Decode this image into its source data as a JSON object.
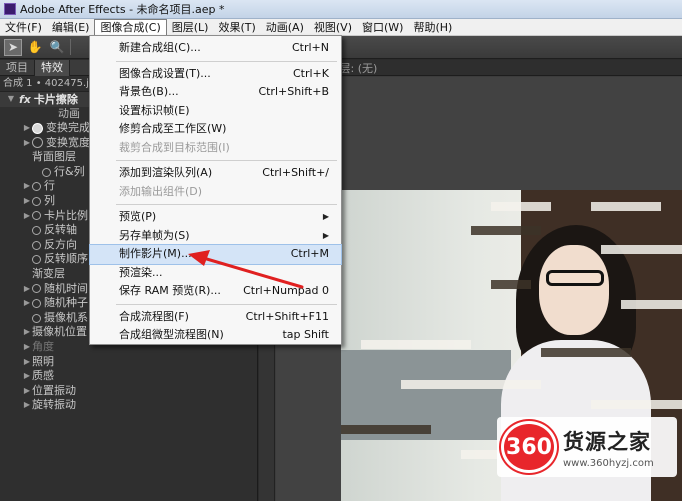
{
  "window": {
    "title": "Adobe After Effects - 未命名项目.aep *"
  },
  "menubar": {
    "items": [
      "文件(F)",
      "编辑(E)",
      "图像合成(C)",
      "图层(L)",
      "效果(T)",
      "动画(A)",
      "视图(V)",
      "窗口(W)",
      "帮助(H)"
    ],
    "active_index": 2
  },
  "left_panel": {
    "tabs": [
      "项目",
      "特效"
    ],
    "comp_label": "合成 1 • 402475.jp",
    "effect_name": "卡片擦除",
    "effect_sub": "动画",
    "properties": [
      {
        "label": "变换完成",
        "indent": 1,
        "tri": true,
        "stopwatch": "on"
      },
      {
        "label": "变换宽度",
        "indent": 1,
        "tri": true,
        "stopwatch": "off"
      },
      {
        "label": "背面图层",
        "indent": 1,
        "tri": false,
        "stopwatch": "none"
      },
      {
        "label": "行&列",
        "indent": 2,
        "tri": false,
        "stopwatch": "small"
      },
      {
        "label": "行",
        "indent": 1,
        "tri": true,
        "stopwatch": "small"
      },
      {
        "label": "列",
        "indent": 1,
        "tri": true,
        "stopwatch": "small"
      },
      {
        "label": "卡片比例",
        "indent": 1,
        "tri": true,
        "stopwatch": "small"
      },
      {
        "label": "反转轴",
        "indent": 1,
        "tri": false,
        "stopwatch": "small"
      },
      {
        "label": "反方向",
        "indent": 1,
        "tri": false,
        "stopwatch": "small"
      },
      {
        "label": "反转顺序",
        "indent": 1,
        "tri": false,
        "stopwatch": "small"
      },
      {
        "label": "渐变层",
        "indent": 1,
        "tri": false,
        "stopwatch": "none"
      },
      {
        "label": "随机时间",
        "indent": 1,
        "tri": true,
        "stopwatch": "small"
      },
      {
        "label": "随机种子",
        "indent": 1,
        "tri": true,
        "stopwatch": "small"
      },
      {
        "label": "摄像机系",
        "indent": 1,
        "tri": false,
        "stopwatch": "small"
      },
      {
        "label": "摄像机位置",
        "indent": 0,
        "tri": true,
        "stopwatch": "none"
      },
      {
        "label": "角度",
        "indent": 0,
        "tri": true,
        "stopwatch": "none",
        "dim": true
      },
      {
        "label": "照明",
        "indent": 0,
        "tri": true,
        "stopwatch": "none"
      },
      {
        "label": "质感",
        "indent": 0,
        "tri": true,
        "stopwatch": "none"
      },
      {
        "label": "位置振动",
        "indent": 0,
        "tri": true,
        "stopwatch": "none"
      },
      {
        "label": "旋转振动",
        "indent": 0,
        "tri": true,
        "stopwatch": "none"
      }
    ]
  },
  "viewer": {
    "comp_tab": "成 1",
    "layer_tab": "图层: (无)"
  },
  "dropdown": {
    "groups": [
      [
        {
          "label": "新建合成组(C)...",
          "shortcut": "Ctrl+N"
        }
      ],
      [
        {
          "label": "图像合成设置(T)...",
          "shortcut": "Ctrl+K"
        },
        {
          "label": "背景色(B)...",
          "shortcut": "Ctrl+Shift+B"
        },
        {
          "label": "设置标识帧(E)",
          "shortcut": ""
        },
        {
          "label": "修剪合成至工作区(W)",
          "shortcut": ""
        },
        {
          "label": "裁剪合成到目标范围(I)",
          "shortcut": "",
          "disabled": true
        }
      ],
      [
        {
          "label": "添加到渲染队列(A)",
          "shortcut": "Ctrl+Shift+/"
        },
        {
          "label": "添加输出组件(D)",
          "shortcut": "",
          "disabled": true
        }
      ],
      [
        {
          "label": "预览(P)",
          "shortcut": "",
          "submenu": true
        },
        {
          "label": "另存单帧为(S)",
          "shortcut": "",
          "submenu": true
        },
        {
          "label": "制作影片(M)...",
          "shortcut": "Ctrl+M",
          "highlight": true
        },
        {
          "label": "预渲染...",
          "shortcut": ""
        },
        {
          "label": "保存 RAM 预览(R)...",
          "shortcut": "Ctrl+Numpad 0"
        }
      ],
      [
        {
          "label": "合成流程图(F)",
          "shortcut": "Ctrl+Shift+F11"
        },
        {
          "label": "合成组微型流程图(N)",
          "shortcut": "tap Shift"
        }
      ]
    ]
  },
  "watermark": {
    "logo": "360",
    "title": "货源之家",
    "url": "www.360hyzj.com"
  },
  "colors": {
    "menu_highlight": "#d4e4f7",
    "arrow": "#e02020",
    "watermark_red": "#e8262b"
  }
}
